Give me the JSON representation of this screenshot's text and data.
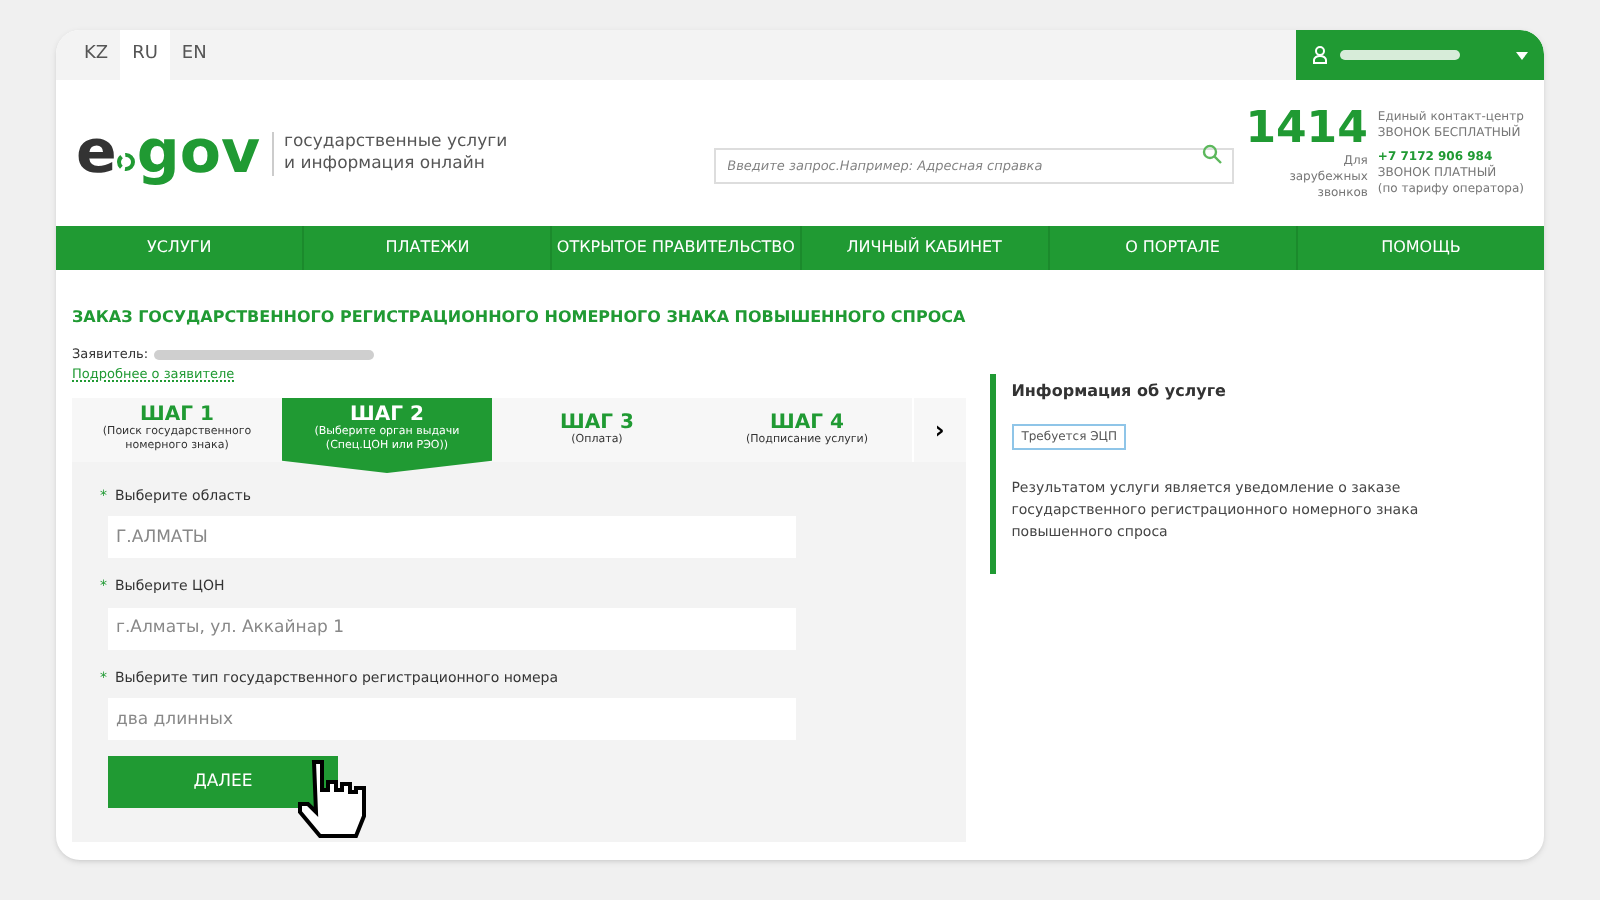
{
  "languages": [
    {
      "label": "KZ",
      "selected": false
    },
    {
      "label": "RU",
      "selected": true
    },
    {
      "label": "EN",
      "selected": false
    }
  ],
  "logo": {
    "first": "e",
    "second": "gov"
  },
  "tagline": [
    "государственные услуги",
    "и информация онлайн"
  ],
  "search": {
    "placeholder": "Введите запрос.Например: Адресная справка"
  },
  "contact": {
    "number": "1414",
    "abroad": "Для зарубежных звонков",
    "free_title": "Единый контакт-центр",
    "free_note": "ЗВОНОК БЕСПЛАТНЫЙ",
    "phone": "+7 7172 906 984",
    "paid_note": "ЗВОНОК ПЛАТНЫЙ",
    "paid_hint": "(по тарифу оператора)"
  },
  "nav": [
    "УСЛУГИ",
    "ПЛАТЕЖИ",
    "ОТКРЫТОЕ ПРАВИТЕЛЬСТВО",
    "ЛИЧНЫЙ КАБИНЕТ",
    "О ПОРТАЛЕ",
    "ПОМОЩЬ"
  ],
  "page_title": "ЗАКАЗ ГОСУДАРСТВЕННОГО РЕГИСТРАЦИОННОГО НОМЕРНОГО ЗНАКА ПОВЫШЕННОГО СПРОСА",
  "applicant": {
    "label": "Заявитель:",
    "link": "Подробнее о заявителе"
  },
  "steps": [
    {
      "title": "ШАГ 1",
      "subtitle": "(Поиск государственного номерного знака)",
      "selected": false
    },
    {
      "title": "ШАГ 2",
      "subtitle": "(Выберите орган выдачи (Спец.ЦОН или РЭО))",
      "selected": true
    },
    {
      "title": "ШАГ 3",
      "subtitle": "(Оплата)",
      "selected": false
    },
    {
      "title": "ШАГ 4",
      "subtitle": "(Подписание услуги)",
      "selected": false
    }
  ],
  "steps_next": "›",
  "fields": [
    {
      "label": "Выберите область",
      "value": "Г.АЛМАТЫ",
      "required": true
    },
    {
      "label": "Выберите ЦОН",
      "value": "г.Алматы, ул. Аккайнар 1",
      "required": true
    },
    {
      "label": "Выберите тип государственного регистрационного номера",
      "value": "два длинных",
      "required": true
    }
  ],
  "required_mark": "*",
  "submit": "ДАЛЕЕ",
  "info": {
    "title": "Информация об услуге",
    "badge": "Требуется ЭЦП",
    "text": "Результатом услуги является уведомление о заказе государственного регистрационного номерного знака повышенного спроса"
  }
}
